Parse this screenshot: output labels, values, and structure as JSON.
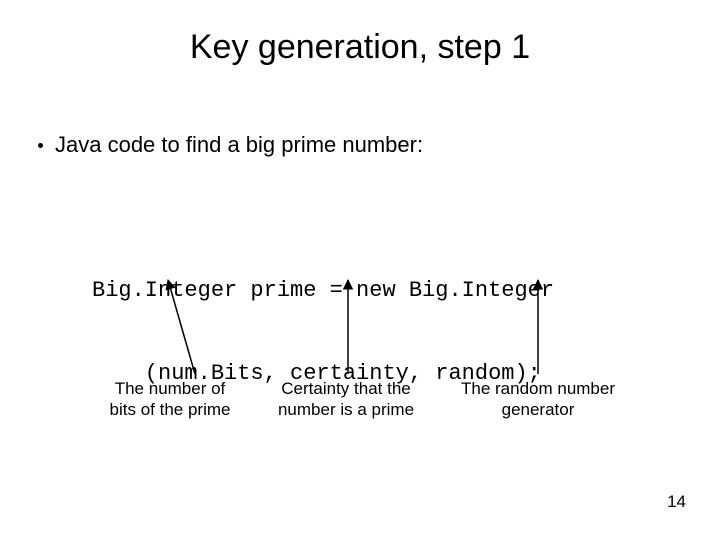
{
  "title": "Key generation, step 1",
  "bullet": "Java code to find a big prime number:",
  "code": {
    "line1": "Big.Integer prime = new Big.Integer",
    "line2": "    (num.Bits, certainty, random);"
  },
  "annotations": {
    "bits": "The number of\nbits of the prime",
    "certainty": "Certainty that the\nnumber is a prime",
    "random": "The random number\ngenerator"
  },
  "page_number": "14"
}
